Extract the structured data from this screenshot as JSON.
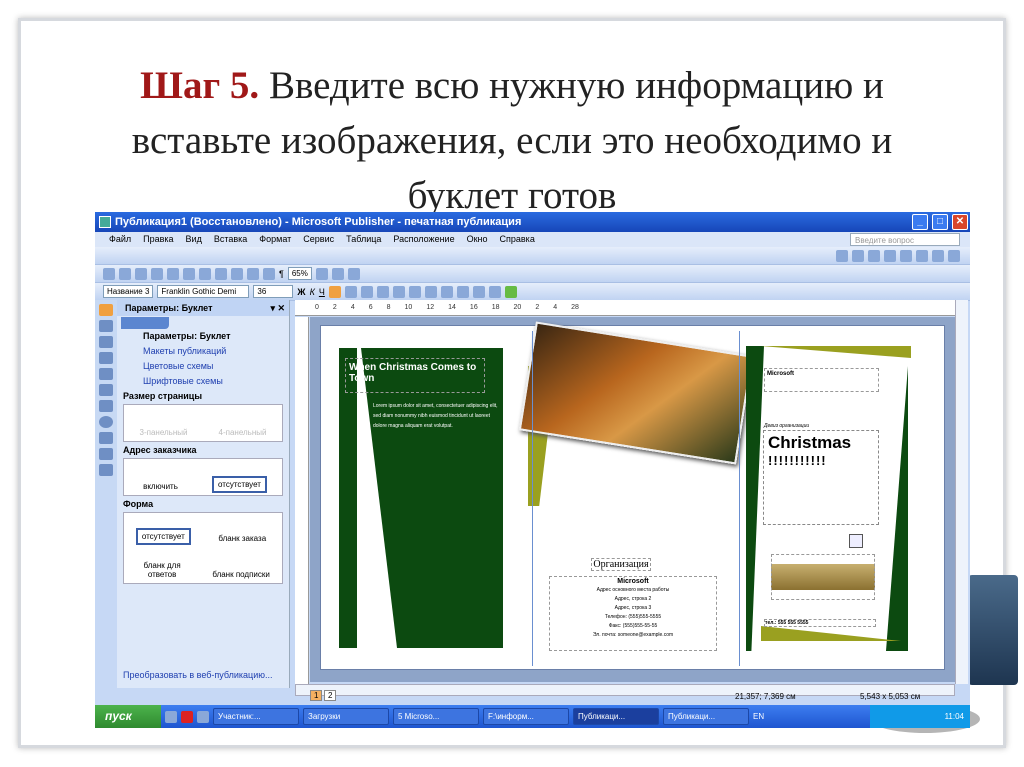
{
  "slide": {
    "step": "Шаг 5.",
    "line1": " Введите всю нужную информацию и",
    "line2": "вставьте изображения, если это необходимо и",
    "line3": "буклет готов"
  },
  "window": {
    "title": "Публикация1 (Восстановлено) - Microsoft Publisher - печатная публикация"
  },
  "menu": [
    "Файл",
    "Правка",
    "Вид",
    "Вставка",
    "Формат",
    "Сервис",
    "Таблица",
    "Расположение",
    "Окно",
    "Справка"
  ],
  "ask_placeholder": "Введите вопрос",
  "toolbar": {
    "zoom": "65%",
    "style": "Название 3",
    "font": "Franklin Gothic Demi",
    "size": "36",
    "bold": "Ж",
    "italic": "К",
    "underline": "Ч"
  },
  "pane": {
    "title": "Параметры: Буклет",
    "links": [
      "Параметры: Буклет",
      "Макеты публикаций",
      "Цветовые схемы",
      "Шрифтовые схемы"
    ],
    "page_size": {
      "label": "Размер страницы",
      "options": [
        "3-панельный",
        "4-панельный"
      ]
    },
    "address": {
      "label": "Адрес заказчика",
      "options": [
        "включить",
        "отсутствует"
      ]
    },
    "form": {
      "label": "Форма",
      "options": [
        "отсутствует",
        "бланк заказа",
        "бланк для ответов",
        "бланк подписки"
      ]
    },
    "convert": "Преобразовать в веб-публикацию..."
  },
  "ruler": [
    "0",
    "2",
    "4",
    "6",
    "8",
    "10",
    "12",
    "14",
    "16",
    "18",
    "20",
    "2",
    "4",
    "28"
  ],
  "doc": {
    "heading": "When Christmas Comes to Town",
    "body": "Lorem ipsum dolor sit amet, consectetuer adipiscing elit, sed diam nonummy nibh euismod tincidunt ut laoreet dolore magna aliquam erat volutpat.",
    "org": "Организация",
    "company": "Microsoft",
    "addr": [
      "Адрес основного места работы",
      "Адрес, строка 2",
      "Адрес, строка 3",
      "Телефон: (555)555-5555",
      "Факс: (555)555-55-55",
      "Эл. почта: someone@example.com"
    ],
    "company2": "Microsoft",
    "motto": "Девиз организации",
    "big": "Christmas",
    "bang": "!!!!!!!!!!!",
    "phone": "тел.: 555 555 5555"
  },
  "status": {
    "pages": [
      "1",
      "2"
    ],
    "position": "21,357; 7,369 см",
    "size": "5,543 x 5,053 см"
  },
  "taskbar": {
    "start": "пуск",
    "items": [
      "Участник:...",
      "Загрузки",
      "5 Microso...",
      "F:\\информ...",
      "Публикаци...",
      "Публикаци..."
    ],
    "lang": "EN",
    "time": "11:04"
  }
}
